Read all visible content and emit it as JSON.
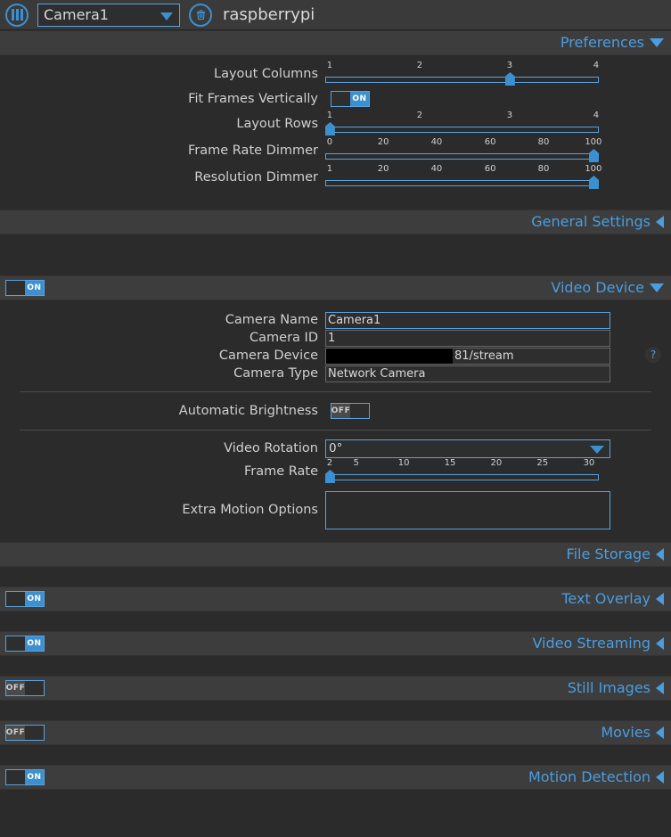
{
  "topbar": {
    "menu_icon": "menu-bars-icon",
    "camera_selected": "Camera1",
    "delete_icon": "trash-icon",
    "hostname": "raspberrypi"
  },
  "sections": {
    "preferences": {
      "title": "Preferences",
      "state": "expanded",
      "arrow": "chevron-down-icon"
    },
    "general_settings": {
      "title": "General Settings",
      "state": "collapsed",
      "arrow": "chevron-left-icon"
    },
    "video_device": {
      "title": "Video Device",
      "state": "expanded",
      "arrow": "chevron-down-icon",
      "enabled": "ON"
    },
    "file_storage": {
      "title": "File Storage",
      "state": "collapsed",
      "arrow": "chevron-left-icon"
    },
    "text_overlay": {
      "title": "Text Overlay",
      "state": "collapsed",
      "arrow": "chevron-left-icon",
      "enabled": "ON"
    },
    "video_streaming": {
      "title": "Video Streaming",
      "state": "collapsed",
      "arrow": "chevron-left-icon",
      "enabled": "ON"
    },
    "still_images": {
      "title": "Still Images",
      "state": "collapsed",
      "arrow": "chevron-left-icon",
      "enabled": "OFF"
    },
    "movies": {
      "title": "Movies",
      "state": "collapsed",
      "arrow": "chevron-left-icon",
      "enabled": "OFF"
    },
    "motion_detection": {
      "title": "Motion Detection",
      "state": "collapsed",
      "arrow": "chevron-left-icon",
      "enabled": "ON"
    }
  },
  "preferences": {
    "layout_columns": {
      "label": "Layout Columns",
      "ticks": [
        "1",
        "2",
        "3",
        "4"
      ],
      "value": 3,
      "min": 1,
      "max": 4
    },
    "fit_frames_vertically": {
      "label": "Fit Frames Vertically",
      "value": "ON"
    },
    "layout_rows": {
      "label": "Layout Rows",
      "ticks": [
        "1",
        "2",
        "3",
        "4"
      ],
      "value": 1,
      "min": 1,
      "max": 4
    },
    "frame_rate_dimmer": {
      "label": "Frame Rate Dimmer",
      "ticks": [
        "0",
        "20",
        "40",
        "60",
        "80",
        "100"
      ],
      "value": 100,
      "min": 0,
      "max": 100
    },
    "resolution_dimmer": {
      "label": "Resolution Dimmer",
      "ticks": [
        "1",
        "20",
        "40",
        "60",
        "80",
        "100"
      ],
      "value": 100,
      "min": 1,
      "max": 100
    }
  },
  "video_device": {
    "camera_name": {
      "label": "Camera Name",
      "value": "Camera1"
    },
    "camera_id": {
      "label": "Camera ID",
      "value": "1"
    },
    "camera_device": {
      "label": "Camera Device",
      "value": "81/stream",
      "redacted": true
    },
    "camera_type": {
      "label": "Camera Type",
      "value": "Network Camera"
    },
    "automatic_brightness": {
      "label": "Automatic Brightness",
      "value": "OFF"
    },
    "video_rotation": {
      "label": "Video Rotation",
      "value": "0°"
    },
    "frame_rate": {
      "label": "Frame Rate",
      "ticks": [
        "2",
        "5",
        "10",
        "15",
        "20",
        "25",
        "30"
      ],
      "value": 2,
      "min": 2,
      "max": 30
    },
    "extra_motion_options": {
      "label": "Extra Motion Options",
      "value": ""
    },
    "help": "?"
  },
  "colors": {
    "accent": "#3d90d0",
    "link": "#4a9de0",
    "band": "#3d3d3d",
    "body": "#2b2b2b",
    "topbar": "#3a3a3a"
  }
}
